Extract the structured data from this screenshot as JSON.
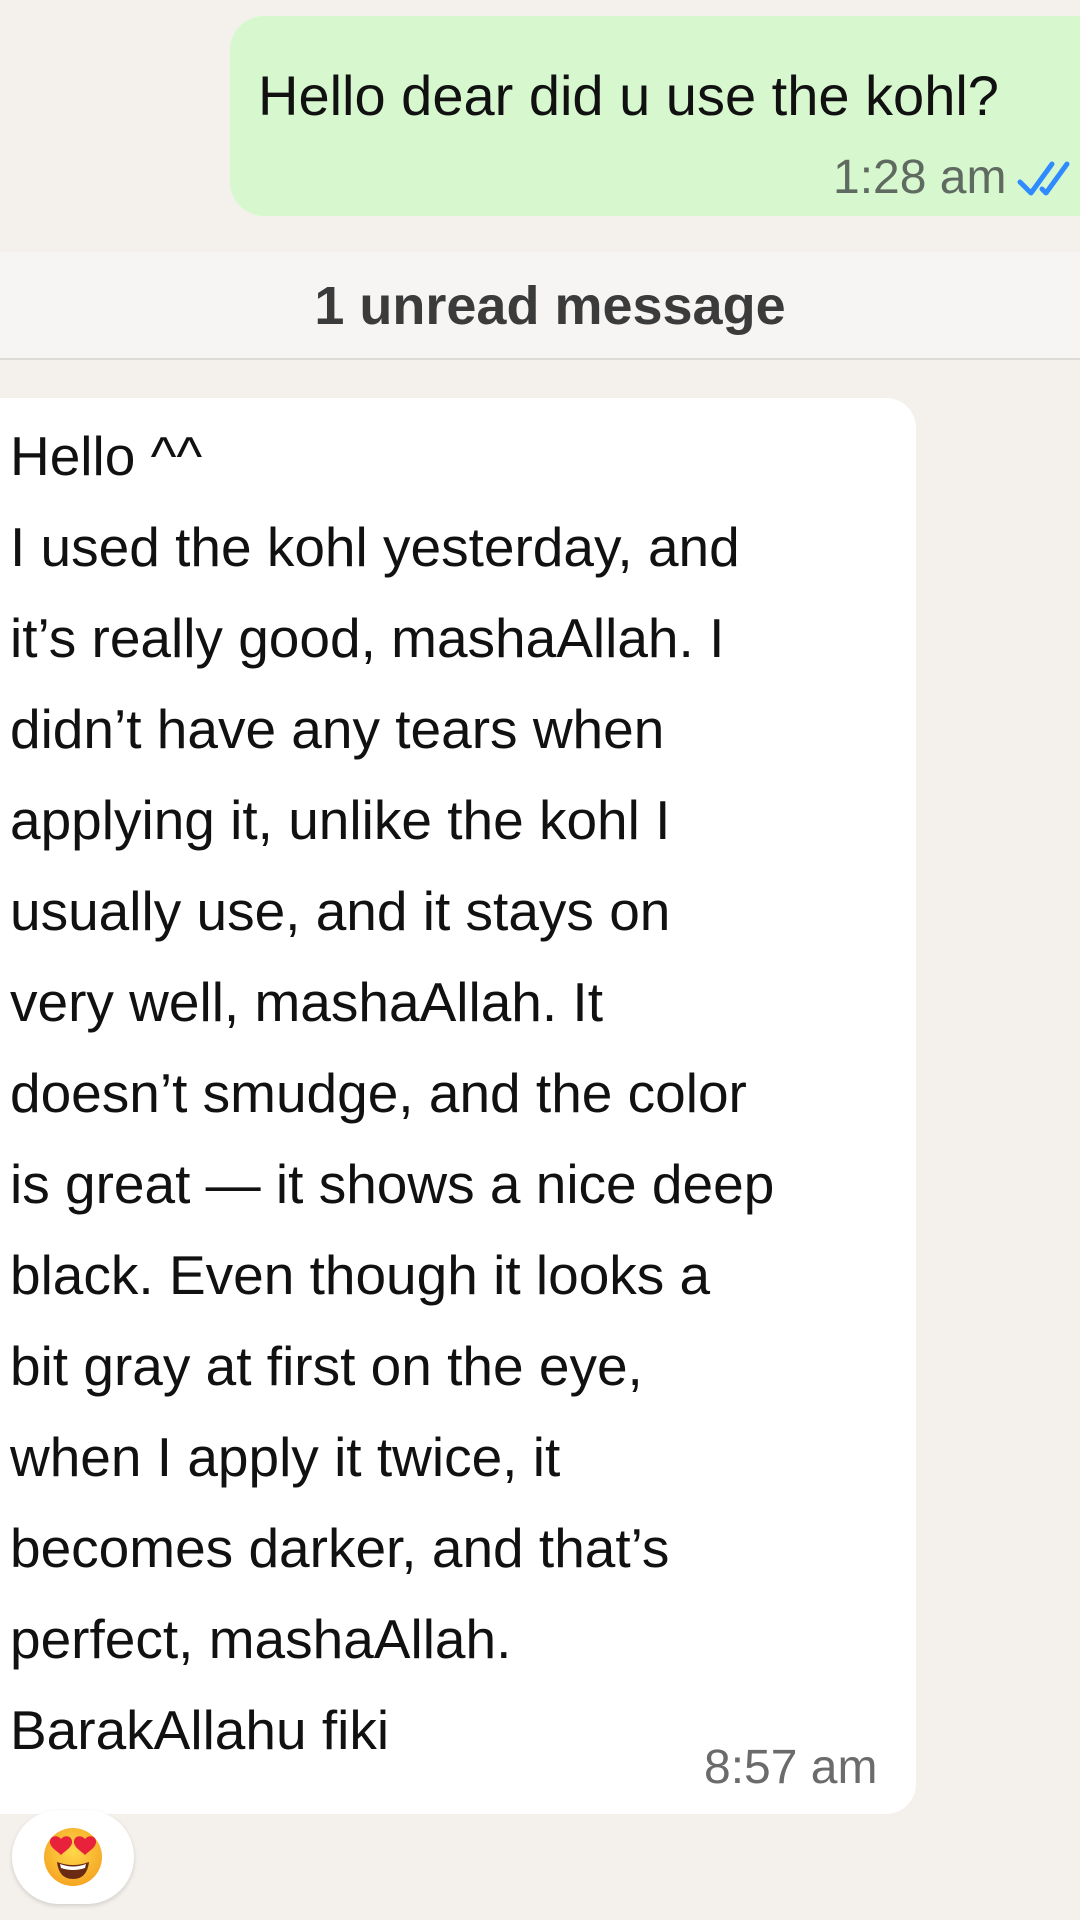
{
  "outgoing_message": {
    "text": "Hello dear did u use the kohl?",
    "time": "1:28 am",
    "status_icon": "double-check-read-icon",
    "bubble_color": "#d7f8cf",
    "tick_color": "#2f8bff"
  },
  "unread_divider": {
    "label": "1 unread message"
  },
  "incoming_message": {
    "lines": [
      "Hello ^^",
      "I used the kohl yesterday, and",
      "it’s really good, mashaAllah. I",
      "didn’t have any tears when",
      "applying it, unlike the kohl I",
      "usually use, and it stays on",
      "very well, mashaAllah. It",
      "doesn’t smudge, and the color",
      "is great — it shows a nice deep",
      "black. Even though it looks a",
      "bit gray at first on the eye,",
      "when I apply it twice, it",
      "becomes darker, and that’s",
      "perfect, mashaAllah.",
      "BarakAllahu fiki"
    ],
    "time": "8:57 am",
    "bubble_color": "#ffffff"
  },
  "reaction": {
    "emoji_icon": "heart-eyes-emoji-icon"
  },
  "background_color": "#f4f1ec"
}
